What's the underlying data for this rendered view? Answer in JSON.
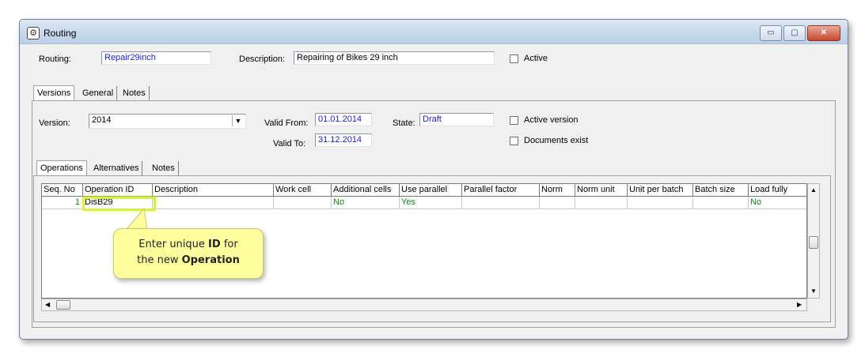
{
  "window": {
    "title": "Routing",
    "minimize": "▭",
    "maximize": "▢",
    "close": "✕"
  },
  "routing": {
    "routing_label": "Routing:",
    "routing_value": "Repair29inch",
    "description_label": "Description:",
    "description_value": "Repairing of Bikes 29 inch",
    "active_label": "Active"
  },
  "tabs": [
    {
      "label": "Versions",
      "selected": true
    },
    {
      "label": "General",
      "selected": false
    },
    {
      "label": "Notes",
      "selected": false
    }
  ],
  "version": {
    "version_label": "Version:",
    "version_value": "2014",
    "valid_from_label": "Valid From:",
    "valid_from_value": "01.01.2014",
    "valid_to_label": "Valid To:",
    "valid_to_value": "31.12.2014",
    "state_label": "State:",
    "state_value": "Draft",
    "active_version_label": "Active version",
    "documents_exist_label": "Documents exist"
  },
  "subtabs": [
    {
      "label": "Operations",
      "selected": true
    },
    {
      "label": "Alternatives",
      "selected": false
    },
    {
      "label": "Notes",
      "selected": false
    }
  ],
  "grid": {
    "columns": [
      "Seq. No",
      "Operation ID",
      "Description",
      "Work cell",
      "Additional cells",
      "Use parallel",
      "Parallel factor",
      "Norm",
      "Norm unit",
      "Unit per batch",
      "Batch size",
      "Load fully"
    ],
    "rows": [
      [
        "1",
        "DisB29",
        "",
        "",
        "No",
        "Yes",
        "",
        "",
        "",
        "",
        "",
        "No"
      ]
    ]
  },
  "callout": {
    "line1_prefix": "Enter unique ",
    "line1_bold": "ID",
    "line1_suffix": " for",
    "line2_prefix": "the new ",
    "line2_bold": "Operation"
  },
  "colors": {
    "link_blue": "#1a1ae0",
    "value_green": "#0a8a0a",
    "callout_yellow": "#ffff9e"
  }
}
